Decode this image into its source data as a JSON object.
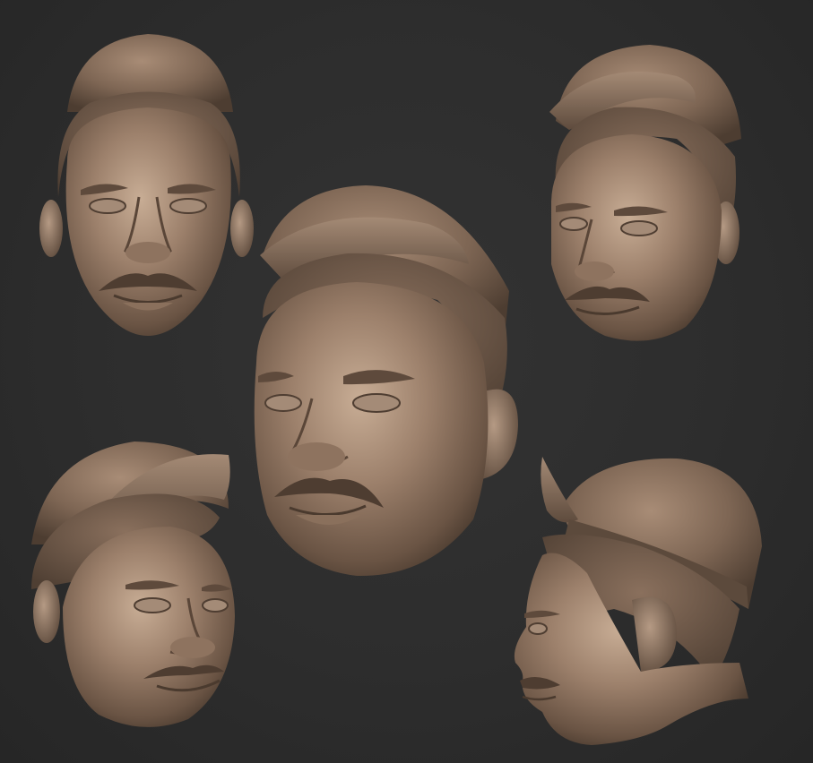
{
  "scene": {
    "background_color": "#2b2b2b",
    "clay_color": "#8a7260",
    "clay_shadow": "#4a3a2e",
    "clay_highlight": "#c9ae96",
    "renders": [
      {
        "view": "front",
        "icon": "sculpt-head-front-view"
      },
      {
        "view": "three-quarter-left",
        "icon": "sculpt-head-three-quarter-view"
      },
      {
        "view": "three-quarter-main",
        "icon": "sculpt-head-main-view"
      },
      {
        "view": "low-angle-right",
        "icon": "sculpt-head-low-angle-view"
      },
      {
        "view": "profile-left",
        "icon": "sculpt-head-profile-view"
      }
    ]
  }
}
